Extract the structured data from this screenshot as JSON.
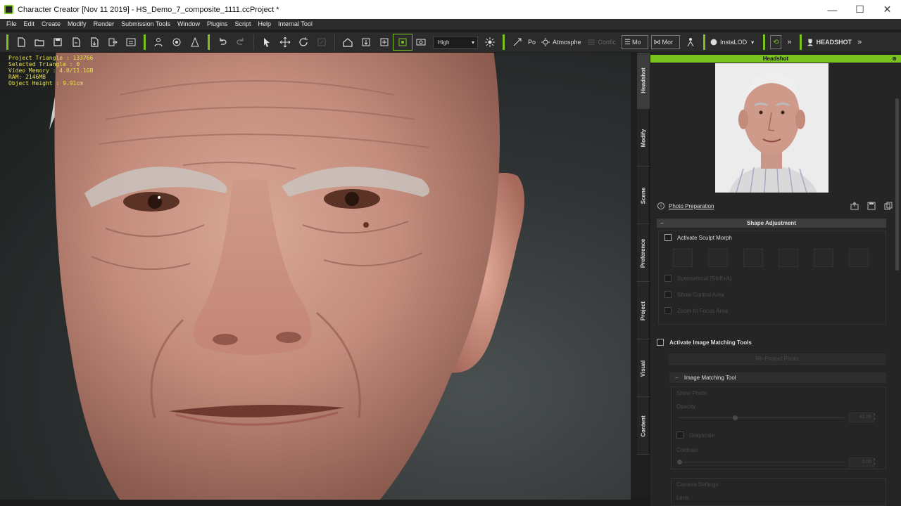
{
  "window": {
    "title": "Character Creator [Nov 11 2019] - HS_Demo_7_composite_1111.ccProject *",
    "minimize": "—",
    "maximize": "☐",
    "close": "✕"
  },
  "menu": [
    "File",
    "Edit",
    "Create",
    "Modify",
    "Render",
    "Submission Tools",
    "Window",
    "Plugins",
    "Script",
    "Help",
    "Internal Tool"
  ],
  "toolbar": {
    "quality": "High",
    "pose_label": "Po",
    "atmosphere_label": "Atmosphe",
    "config_label": "Confic",
    "mod1_label": "Mo",
    "mod2_label": "Mor",
    "instalod_label": "InstaLOD",
    "headshot_label": "HEADSHOT",
    "more": "»"
  },
  "viewport": {
    "stats": [
      "Project Triangle : 133766",
      "Selected Triangle : 0",
      "Video Memory : 4.0/11.1GB",
      "RAM: 2146MB",
      "Object Height : 9.91cm"
    ]
  },
  "vtabs": [
    "Headshot",
    "Modify",
    "Scene",
    "Preference",
    "Project",
    "Visual",
    "Content"
  ],
  "panel": {
    "header": "Headshot",
    "close": "⊗",
    "info": "i",
    "photo_preparation": "Photo Preparation",
    "shape_adjustment": "Shape Adjustment",
    "section_minus": "−",
    "activate_sculpt_morph": "Activate Sculpt Morph",
    "symmetrical": "Symmetrical (Shift+A)",
    "show_control_area": "Show Control Area",
    "zoom_to_focus_area": "Zoom to Focus Area",
    "activate_image_matching": "Activate Image Matching Tools",
    "reproject_photo": "Re-Project Photo",
    "image_matching_tool": "Image Matching Tool",
    "show_photo": "Show Photo",
    "opacity": "Opacity",
    "opacity_value": "41.05",
    "grayscale": "Grayscale",
    "contrast": "Contrast",
    "contrast_value": "0.00",
    "camera_settings": "Camera Settings",
    "lens": "Lens"
  },
  "colors": {
    "accent": "#7ac31f",
    "stats_text": "#e8e04a",
    "panel_bg": "#252525"
  }
}
